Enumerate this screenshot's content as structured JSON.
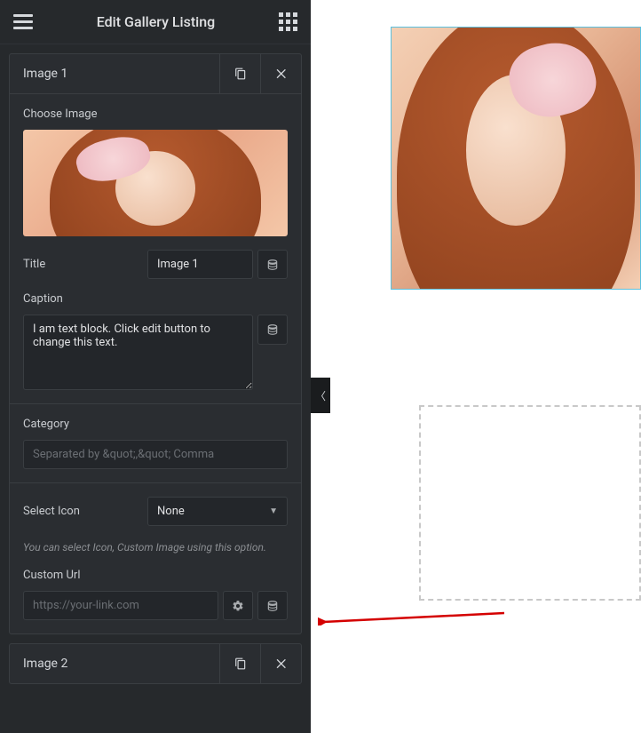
{
  "header": {
    "title": "Edit Gallery Listing"
  },
  "items": [
    {
      "heading": "Image 1",
      "choose_label": "Choose Image",
      "title_label": "Title",
      "title_value": "Image 1",
      "caption_label": "Caption",
      "caption_value": "I am text block. Click edit button to change this text.",
      "category_label": "Category",
      "category_placeholder": "Separated by &quot;,&quot; Comma",
      "select_icon_label": "Select Icon",
      "select_icon_value": "None",
      "select_icon_help": "You can select Icon, Custom Image using this option.",
      "custom_url_label": "Custom Url",
      "custom_url_placeholder": "https://your-link.com"
    },
    {
      "heading": "Image 2"
    }
  ]
}
